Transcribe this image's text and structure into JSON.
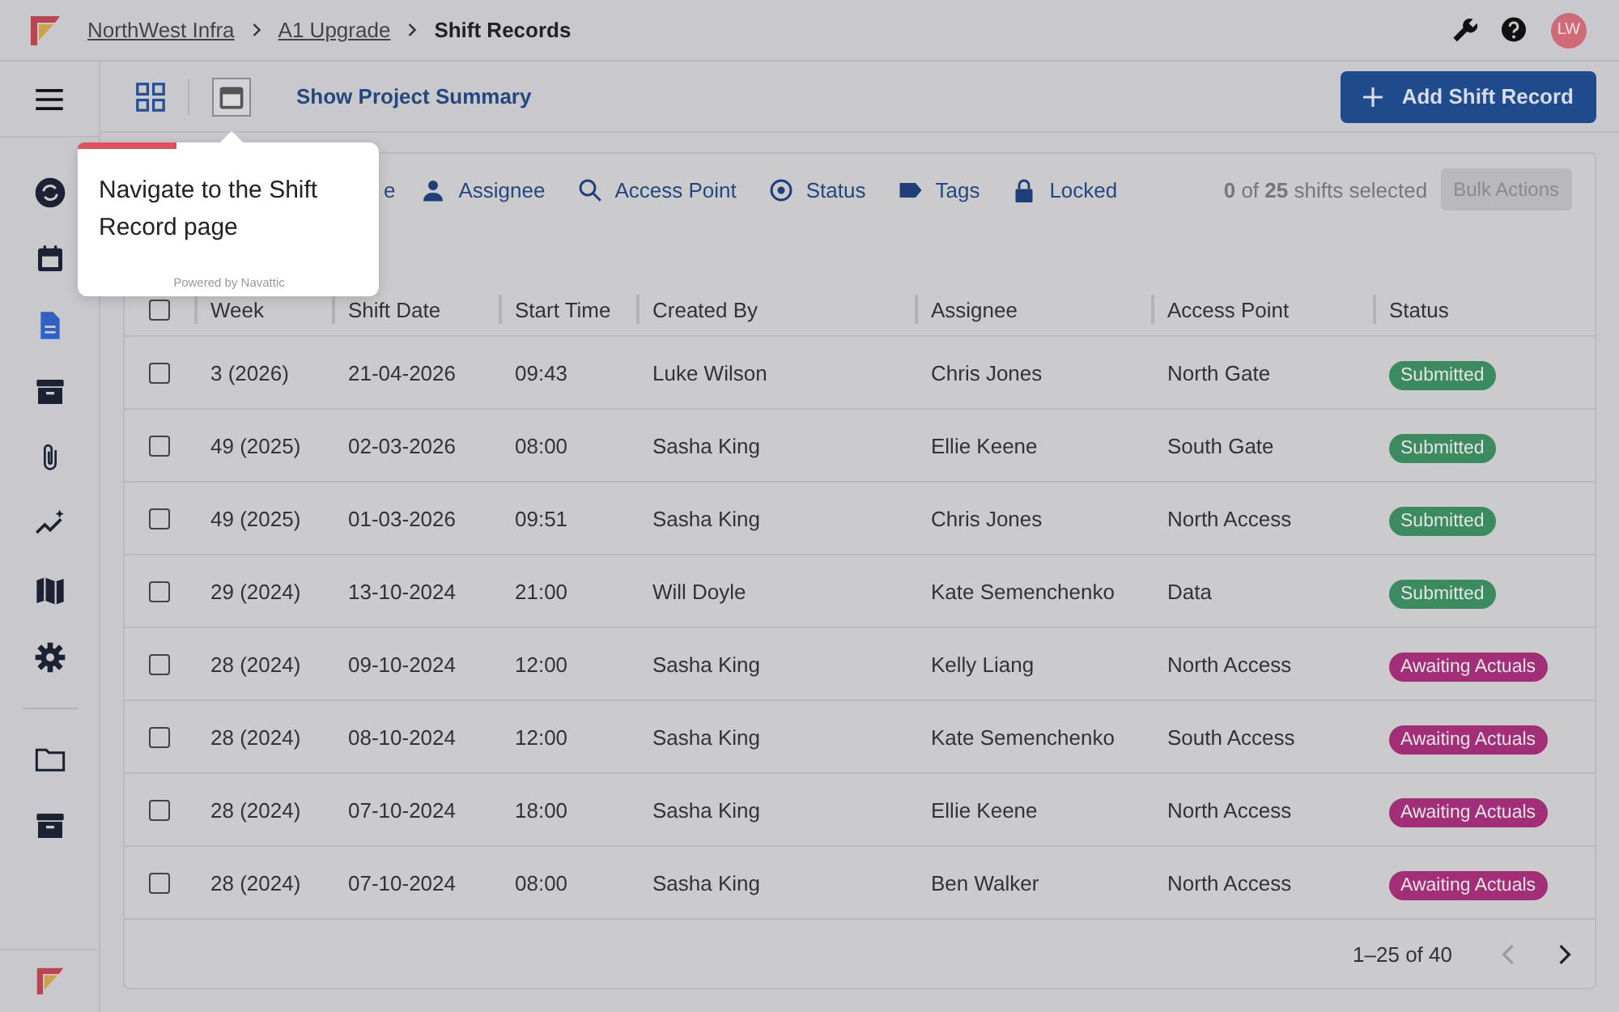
{
  "breadcrumbs": [
    {
      "label": "NorthWest Infra",
      "link": true
    },
    {
      "label": "A1 Upgrade",
      "link": true
    },
    {
      "label": "Shift Records",
      "link": false
    }
  ],
  "user": {
    "initials": "LW"
  },
  "toolbar": {
    "summary_link": "Show Project Summary",
    "add_button": "Add Shift Record"
  },
  "sidebar": {
    "items": [
      {
        "kind": "sync",
        "selected": false
      },
      {
        "kind": "calendar",
        "selected": false
      },
      {
        "kind": "document",
        "selected": true
      },
      {
        "kind": "archive",
        "selected": false
      },
      {
        "kind": "clip",
        "selected": false
      },
      {
        "kind": "trend",
        "selected": false
      },
      {
        "kind": "map",
        "selected": false
      },
      {
        "kind": "gear",
        "selected": false
      },
      {
        "kind": "divider"
      },
      {
        "kind": "folder",
        "selected": false
      },
      {
        "kind": "archive",
        "selected": false
      }
    ]
  },
  "tooltip": {
    "text": "Navigate to the Shift Record page",
    "footer": "Powered by Navattic",
    "level": 0.33
  },
  "filters": [
    {
      "kind": "partial",
      "label": "e"
    },
    {
      "kind": "person",
      "label": "Assignee"
    },
    {
      "kind": "search",
      "label": "Access Point"
    },
    {
      "kind": "status",
      "label": "Status"
    },
    {
      "kind": "tag",
      "label": "Tags"
    },
    {
      "kind": "lock",
      "label": "Locked"
    }
  ],
  "selection": {
    "count": "0",
    "total": "25",
    "text": "shifts selected",
    "of": "of",
    "bulk_button": "Bulk Actions"
  },
  "table": {
    "all_checked": false,
    "columns": [
      "Week",
      "Shift Date",
      "Start Time",
      "Created By",
      "Assignee",
      "Access Point",
      "Status"
    ],
    "rows": [
      {
        "checked": false,
        "cells": [
          "3 (2026)",
          "21-04-2026",
          "09:43",
          "Luke Wilson",
          "Chris Jones",
          "North Gate"
        ],
        "status": "Submitted",
        "color": "#3c8a5f"
      },
      {
        "checked": false,
        "cells": [
          "49 (2025)",
          "02-03-2026",
          "08:00",
          "Sasha King",
          "Ellie Keene",
          "South Gate"
        ],
        "status": "Submitted",
        "color": "#3c8a5f"
      },
      {
        "checked": false,
        "cells": [
          "49 (2025)",
          "01-03-2026",
          "09:51",
          "Sasha King",
          "Chris Jones",
          "North Access"
        ],
        "status": "Submitted",
        "color": "#3c8a5f"
      },
      {
        "checked": false,
        "cells": [
          "29 (2024)",
          "13-10-2024",
          "21:00",
          "Will Doyle",
          "Kate Semenchenko",
          "Data"
        ],
        "status": "Submitted",
        "color": "#3c8a5f"
      },
      {
        "checked": false,
        "cells": [
          "28 (2024)",
          "09-10-2024",
          "12:00",
          "Sasha King",
          "Kelly Liang",
          "North Access"
        ],
        "status": "Awaiting Actuals",
        "color": "#a32e78"
      },
      {
        "checked": false,
        "cells": [
          "28 (2024)",
          "08-10-2024",
          "12:00",
          "Sasha King",
          "Kate Semenchenko",
          "South Access"
        ],
        "status": "Awaiting Actuals",
        "color": "#a32e78"
      },
      {
        "checked": false,
        "cells": [
          "28 (2024)",
          "07-10-2024",
          "18:00",
          "Sasha King",
          "Ellie Keene",
          "North Access"
        ],
        "status": "Awaiting Actuals",
        "color": "#a32e78"
      },
      {
        "checked": false,
        "cells": [
          "28 (2024)",
          "07-10-2024",
          "08:00",
          "Sasha King",
          "Ben Walker",
          "North Access"
        ],
        "status": "Awaiting Actuals",
        "color": "#a32e78"
      }
    ]
  },
  "pagination": {
    "range": "1–25 of 40",
    "prev_disabled": true,
    "next_disabled": false
  }
}
